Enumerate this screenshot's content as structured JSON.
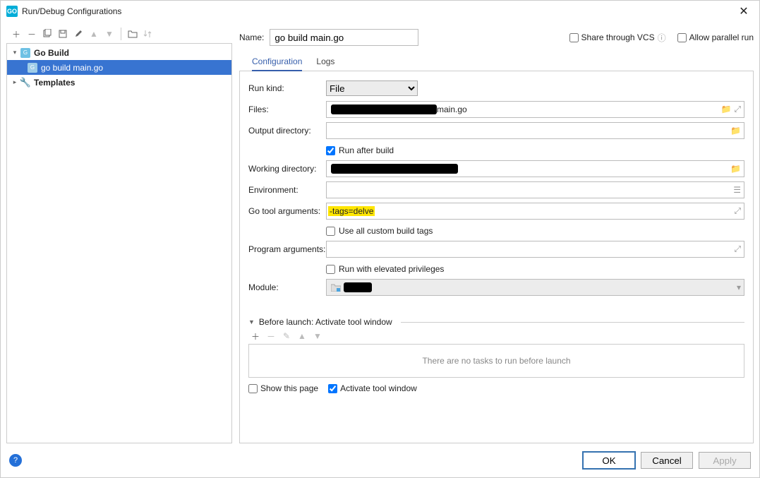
{
  "titlebar": {
    "title": "Run/Debug Configurations"
  },
  "tree": {
    "go_build": "Go Build",
    "config_name": "go build main.go",
    "templates": "Templates"
  },
  "name": {
    "label": "Name:",
    "value": "go build main.go"
  },
  "share_vcs": "Share through VCS",
  "allow_parallel": "Allow parallel run",
  "tabs": {
    "configuration": "Configuration",
    "logs": "Logs"
  },
  "form": {
    "run_kind": {
      "label": "Run kind:",
      "value": "File"
    },
    "files": {
      "label": "Files:",
      "suffix": "main.go"
    },
    "output_dir": {
      "label": "Output directory:",
      "value": ""
    },
    "run_after_build": "Run after build",
    "working_dir": {
      "label": "Working directory:",
      "value": ""
    },
    "environment": {
      "label": "Environment:",
      "value": ""
    },
    "go_tool_args": {
      "label": "Go tool arguments:",
      "value": "-tags=delve"
    },
    "use_custom_tags": "Use all custom build tags",
    "program_args": {
      "label": "Program arguments:",
      "value": ""
    },
    "run_elevated": "Run with elevated privileges",
    "module": {
      "label": "Module:"
    }
  },
  "before_launch": {
    "header": "Before launch: Activate tool window",
    "empty": "There are no tasks to run before launch"
  },
  "footer": {
    "show_page": "Show this page",
    "activate_window": "Activate tool window"
  },
  "buttons": {
    "ok": "OK",
    "cancel": "Cancel",
    "apply": "Apply"
  }
}
